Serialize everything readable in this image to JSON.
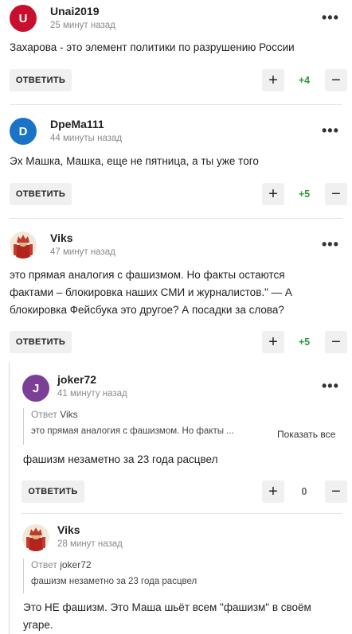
{
  "reply_label": "ОТВЕТИТЬ",
  "more_label": "•••",
  "plus_label": "+",
  "minus_label": "−",
  "comments": [
    {
      "author": "Unai2019",
      "avatar_letter": "U",
      "avatar_color": "#c8102e",
      "time": "25 минут назад",
      "text": "Захарова - это элемент политики по разрушению России",
      "score": "+4"
    },
    {
      "author": "DpeMa111",
      "avatar_letter": "D",
      "avatar_color": "#1a73c6",
      "time": "44 минуты назад",
      "text": "Эх Машка, Машка, еще не пятница, а ты уже того",
      "score": "+5"
    },
    {
      "author": "Viks",
      "time": "47 минут назад",
      "text_lines": [
        "это прямая аналогия с фашизмом. Но факты остаются",
        "фактами – блокировка наших СМИ и журналистов.\" — А",
        "блокировка Фейсбука это другое? А посадки за слова?"
      ],
      "score": "+5"
    },
    {
      "author": "joker72",
      "avatar_letter": "J",
      "avatar_color": "#7b3f98",
      "time": "41 минуту назад",
      "quote_prefix": "Ответ",
      "quote_name": "Viks",
      "quote_text": "это прямая аналогия с фашизмом. Но факты ...",
      "show_all": "Показать все",
      "text": "фашизм незаметно за 23 года расцвел",
      "score": "0"
    },
    {
      "author": "Viks",
      "time": "28 минут назад",
      "quote_prefix": "Ответ",
      "quote_name": "joker72",
      "quote_text": "фашизм незаметно за 23 года расцвел",
      "text_lines": [
        "Это НЕ фашизм. Это Маша шьёт всем \"фашизм\" в своём",
        "угаре."
      ]
    }
  ]
}
